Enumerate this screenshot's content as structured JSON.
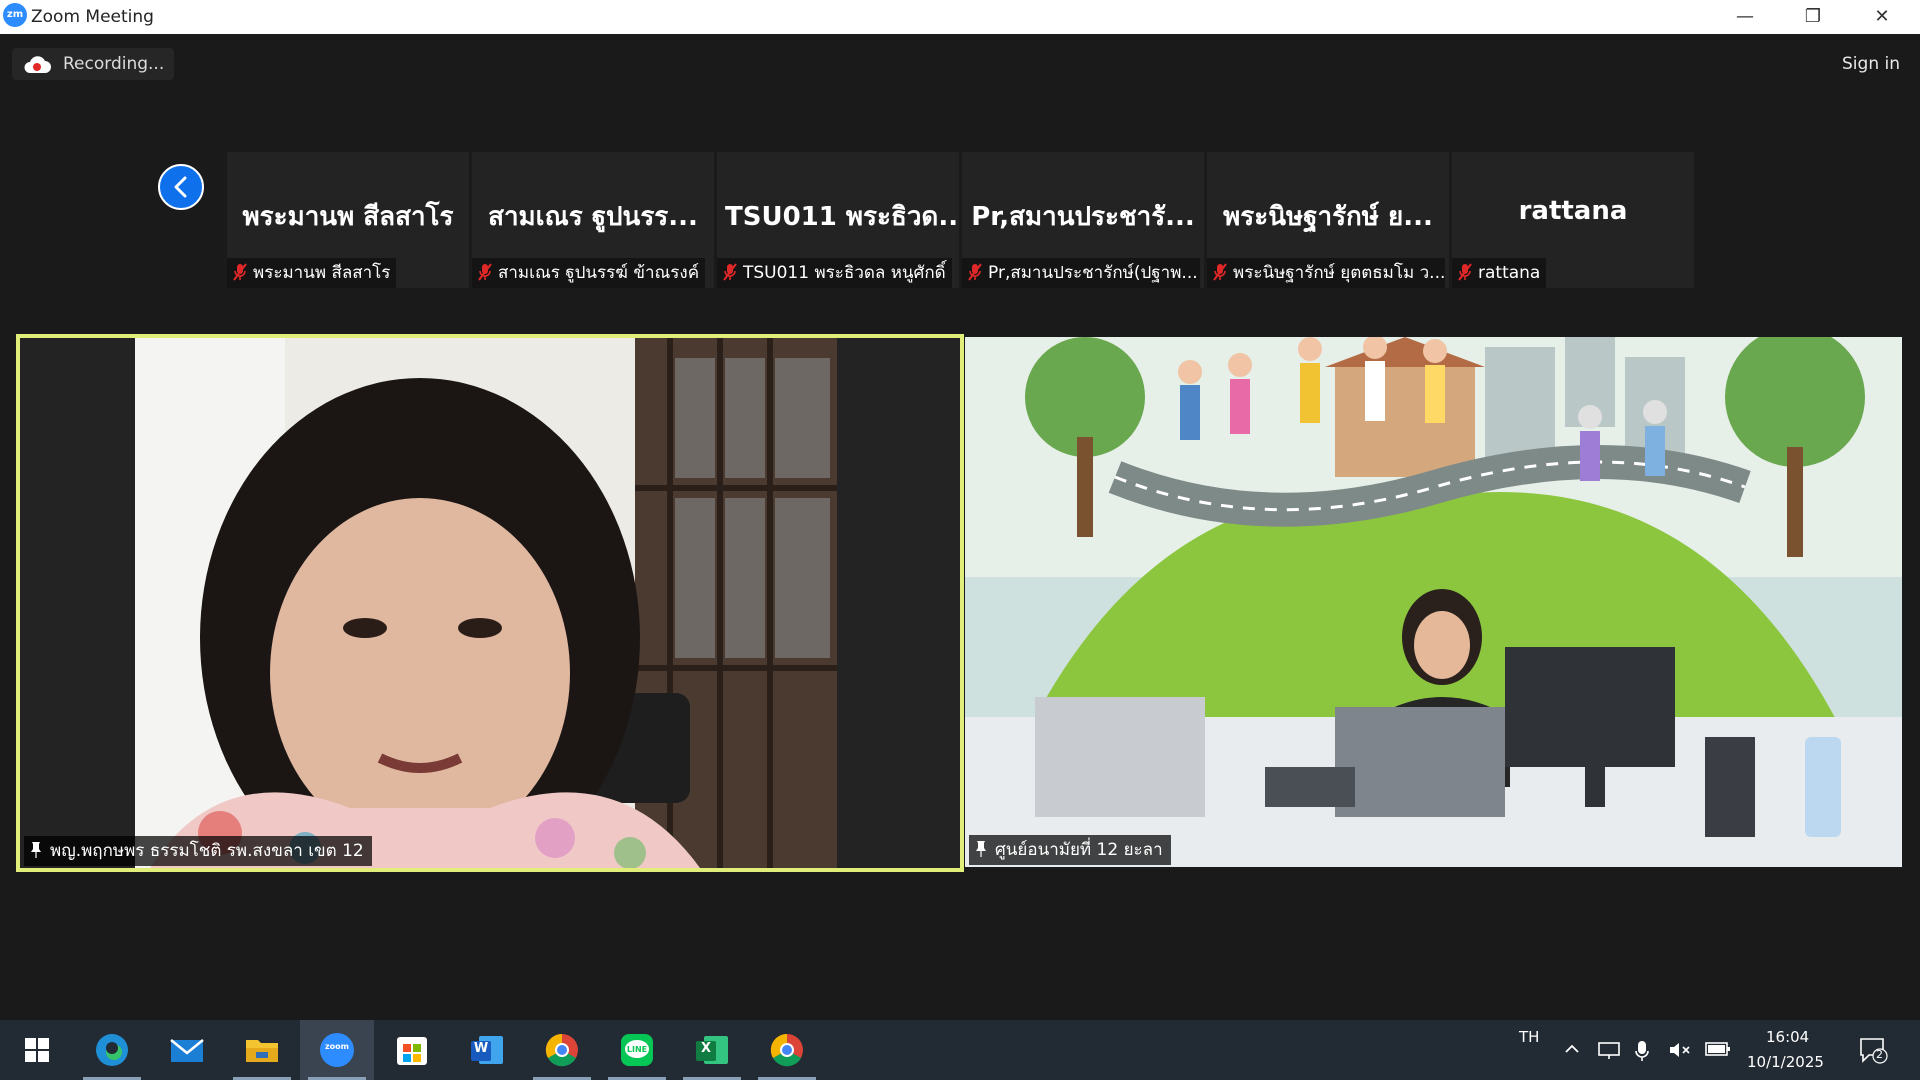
{
  "window": {
    "logo_text": "zm",
    "title": "Zoom Meeting",
    "minimize": "—",
    "restore": "❐",
    "close": "✕"
  },
  "toolbar": {
    "recording_label": "Recording...",
    "sign_in_label": "Sign in"
  },
  "thumbnails": [
    {
      "display_name": "พระมานพ สีลสาโร",
      "label": "พระมานพ สีลสาโร"
    },
    {
      "display_name": "สามเณร ฐูปนรร...",
      "label": "สามเณร ฐูปนรรฆ์ ข้าณรงค์"
    },
    {
      "display_name": "TSU011 พระธิวด...",
      "label": "TSU011 พระธิวดล หนูศักดิ์"
    },
    {
      "display_name": "Pr,สมานประชารั...",
      "label": "Pr,สมานประชารักษ์(ปฐาพ..."
    },
    {
      "display_name": "พระนิษฐารักษ์ ย...",
      "label": "พระนิษฐารักษ์ ยุตตธมโม ว..."
    },
    {
      "display_name": "rattana",
      "label": "rattana"
    }
  ],
  "video_tiles": [
    {
      "name": "พญ.พฤกษพร ธรรมโชติ รพ.สงขลา เขต 12",
      "active_speaker": true
    },
    {
      "name": "ศูนย์อนามัยที่ 12 ยะลา",
      "active_speaker": false
    }
  ],
  "taskbar": {
    "apps": [
      "start",
      "edge",
      "mail",
      "file-explorer",
      "zoom",
      "microsoft-store",
      "word",
      "chrome",
      "line",
      "excel",
      "chrome"
    ],
    "zoom_label": "zoom",
    "word_label": "W",
    "excel_label": "X",
    "line_label": "LINE",
    "language": "TH",
    "time": "16:04",
    "date": "10/1/2025",
    "notification_count": "2"
  },
  "colors": {
    "zoom_blue": "#2d8cff",
    "active_speaker_border": "#e2ee7a",
    "mute_red": "#e02828",
    "taskbar": "#222a33"
  }
}
